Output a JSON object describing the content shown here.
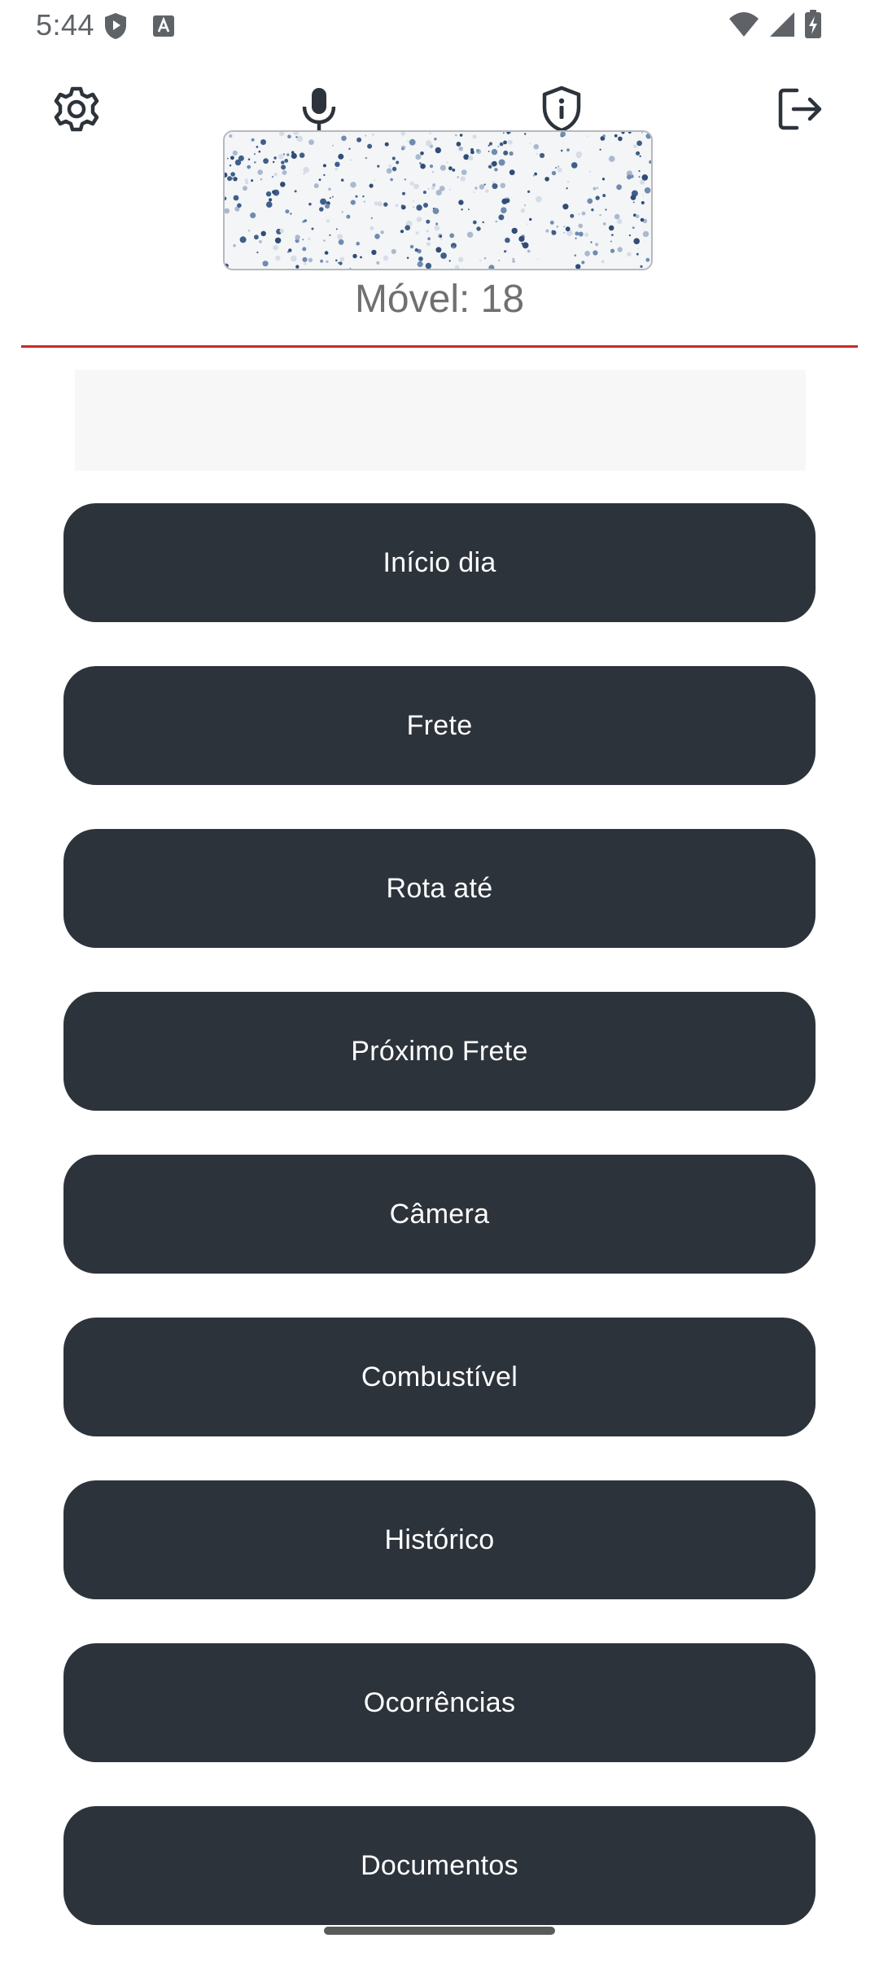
{
  "status_bar": {
    "time": "5:44",
    "left_icons": [
      "shield-play-icon",
      "font-a-icon"
    ],
    "right_icons": [
      "wifi-icon",
      "signal-icon",
      "battery-charging-icon"
    ]
  },
  "header": {
    "icons": [
      "gear-icon",
      "microphone-icon",
      "shield-info-icon",
      "logout-icon"
    ]
  },
  "vehicle": {
    "label": "Móvel: 18"
  },
  "menu": {
    "items": [
      {
        "label": "Início dia"
      },
      {
        "label": "Frete"
      },
      {
        "label": "Rota até"
      },
      {
        "label": "Próximo Frete"
      },
      {
        "label": "Câmera"
      },
      {
        "label": "Combustível"
      },
      {
        "label": "Histórico"
      },
      {
        "label": "Ocorrências"
      },
      {
        "label": "Documentos"
      }
    ]
  },
  "colors": {
    "button_bg": "#2d333b",
    "button_text": "#ffffff",
    "divider": "#c62828",
    "muted_text": "#707070"
  }
}
